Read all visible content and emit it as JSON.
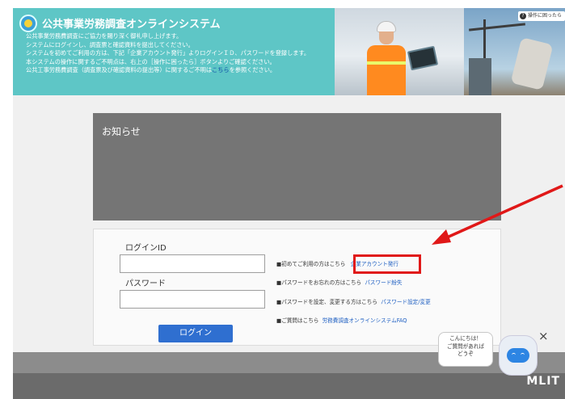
{
  "header": {
    "title": "公共事業労務調査オンラインシステム",
    "intro_lines": [
      "公共事業労務費調査にご協力を賜り深く御礼申し上げます。",
      "システムにログインし、調査票と確認資料を提出してください。",
      "システムを初めてご利用の方は、下記「企業アカウント発行」よりログインＩＤ、パスワードを登録します。",
      "本システムの操作に関するご不明点は、右上の［操作に困ったら］ボタンよりご確認ください。",
      "公共工事労務費調査（調査票及び確認資料の提出等）に関するご不明は"
    ],
    "intro_link": "こちら",
    "intro_tail": "を参照ください。",
    "help_button": "操作に困ったら"
  },
  "notice": {
    "title": "お知らせ"
  },
  "login": {
    "id_label": "ログインID",
    "id_value": "",
    "password_label": "パスワード",
    "password_value": "",
    "button": "ログイン"
  },
  "links": [
    {
      "prefix": "■初めてご利用の方はこちら",
      "link": "企業アカウント発行"
    },
    {
      "prefix": "■パスワードをお忘れの方はこちら",
      "link": "パスワード紛失"
    },
    {
      "prefix": "■パスワードを設定、変更する方はこちら",
      "link": "パスワード設定/変更"
    },
    {
      "prefix": "■ご質問はこちら",
      "link": "労務費調査オンラインシステムFAQ"
    }
  ],
  "chat": {
    "lines": [
      "こんにちは！",
      "ご質問があれば",
      "どうぞ"
    ],
    "close": "×"
  },
  "footer": {
    "logo": "MLIT"
  },
  "colors": {
    "header": "#5ec6c6",
    "notice": "#757575",
    "accent": "#2f6fd0",
    "highlight": "#e01818"
  }
}
